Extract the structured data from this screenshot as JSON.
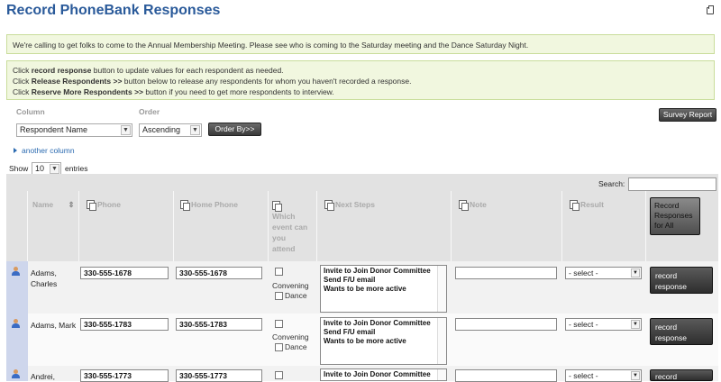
{
  "page": {
    "title": "Record PhoneBank Responses",
    "banner": "We're calling to get folks to come to the Annual Membership Meeting. Please see who is coming to the Saturday meeting and the Dance Saturday Night.",
    "instructions": {
      "line1_pre": "Click ",
      "line1_b": "record response",
      "line1_post": " button to update values for each respondent as needed.",
      "line2_pre": "Click ",
      "line2_b": "Release Respondents >>",
      "line2_post": " button below to release any respondents for whom you haven't recorded a response.",
      "line3_pre": "Click ",
      "line3_b": "Reserve More Respondents >>",
      "line3_post": " button if you need to get more respondents to interview."
    }
  },
  "sort": {
    "column_label": "Column",
    "order_label": "Order",
    "column_value": "Respondent Name",
    "order_value": "Ascending",
    "order_by_button": "Order By>>",
    "survey_report_button": "Survey Report",
    "another_column_link": "another column"
  },
  "table": {
    "show_label": "Show",
    "entries_value": "10",
    "entries_label": "entries",
    "search_label": "Search:",
    "headers": {
      "name": "Name",
      "phone": "Phone",
      "home_phone": "Home Phone",
      "event": "Which event can you attend",
      "next_steps": "Next Steps",
      "note": "Note",
      "result": "Result",
      "record_all": "Record Responses for All"
    },
    "rows": [
      {
        "name": "Adams, Charles",
        "phone": "330-555-1678",
        "home_phone": "330-555-1678",
        "opt1": "Convening",
        "opt2": "Dance",
        "next_steps": "Invite to Join Donor Committee\nSend F/U email\nWants to be more active",
        "result": "- select -",
        "button": "record response"
      },
      {
        "name": "Adams, Mark",
        "phone": "330-555-1783",
        "home_phone": "330-555-1783",
        "opt1": "Convening",
        "opt2": "Dance",
        "next_steps": "Invite to Join Donor Committee\nSend F/U email\nWants to be more active",
        "result": "- select -",
        "button": "record response"
      },
      {
        "name": "Andrei,",
        "phone": "330-555-1773",
        "home_phone": "330-555-1773",
        "opt1": "",
        "opt2": "",
        "next_steps": "Invite to Join Donor Committee",
        "result": "- select -",
        "button": "record"
      }
    ]
  }
}
